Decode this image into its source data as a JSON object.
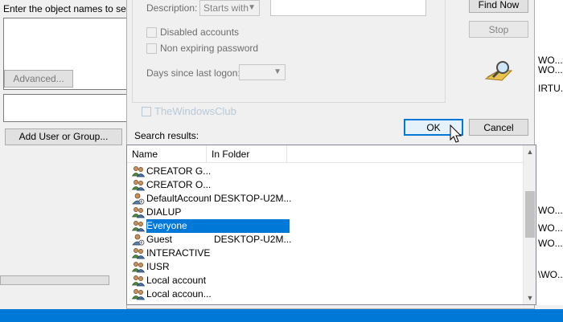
{
  "background_dialog": {
    "label": "Enter the object names to select",
    "advanced_label": "Advanced...",
    "add_label": "Add User or Group..."
  },
  "right_window": {
    "lines": [
      "WO...",
      "WO...",
      "IRTU...",
      "WO...",
      "WO...",
      "WO...",
      "\\WO..."
    ]
  },
  "query": {
    "description_label": "Description:",
    "description_mode": "Starts with",
    "description_value": "",
    "disabled_accounts_label": "Disabled accounts",
    "non_expiring_label": "Non expiring password",
    "days_label": "Days since last logon:",
    "days_value": ""
  },
  "buttons": {
    "find_now": "Find Now",
    "stop": "Stop",
    "ok": "OK",
    "cancel": "Cancel"
  },
  "watermark": "TheWindowsClub",
  "results": {
    "label": "Search results:",
    "columns": [
      "Name",
      "In Folder"
    ],
    "rows": [
      {
        "name": "CREATOR G...",
        "folder": "",
        "icon": "group-icon"
      },
      {
        "name": "CREATOR O...",
        "folder": "",
        "icon": "group-icon"
      },
      {
        "name": "DefaultAccount",
        "folder": "DESKTOP-U2M...",
        "icon": "user-icon"
      },
      {
        "name": "DIALUP",
        "folder": "",
        "icon": "group-icon"
      },
      {
        "name": "Everyone",
        "folder": "",
        "icon": "group-icon"
      },
      {
        "name": "Guest",
        "folder": "DESKTOP-U2M...",
        "icon": "user-icon"
      },
      {
        "name": "INTERACTIVE",
        "folder": "",
        "icon": "group-icon"
      },
      {
        "name": "IUSR",
        "folder": "",
        "icon": "group-icon"
      },
      {
        "name": "Local account",
        "folder": "",
        "icon": "group-icon"
      },
      {
        "name": "Local accoun...",
        "folder": "",
        "icon": "group-icon"
      }
    ],
    "selected_index": 4
  },
  "colors": {
    "selection": "#0078d7",
    "taskbar": "#0078d7",
    "dialog_bg": "#f0f0f0"
  }
}
